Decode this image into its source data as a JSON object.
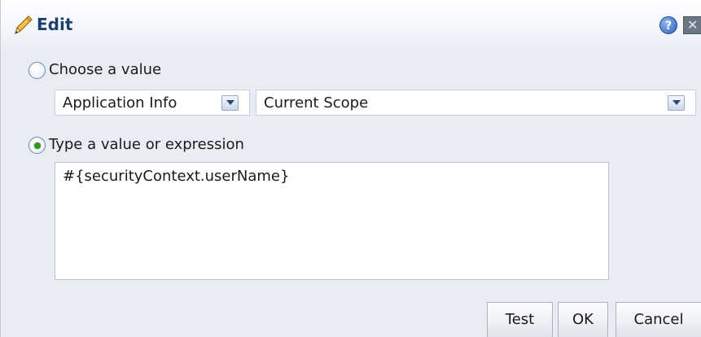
{
  "dialog": {
    "title": "Edit",
    "help_glyph": "?",
    "close_glyph": "✕"
  },
  "choose": {
    "label": "Choose a value",
    "selected": false,
    "source_select": {
      "value": "Application Info"
    },
    "scope_select": {
      "value": "Current Scope"
    }
  },
  "expression": {
    "label": "Type a value or expression",
    "selected": true,
    "value": "#{securityContext.userName}"
  },
  "buttons": {
    "test": "Test",
    "ok": "OK",
    "cancel": "Cancel"
  },
  "icons": {
    "title": "pencil-icon",
    "help": "help-icon",
    "close": "close-icon"
  },
  "colors": {
    "title_text": "#1c3f6e",
    "radio_dot": "#2f9a1e",
    "dialog_bg": "#e9edf3"
  }
}
